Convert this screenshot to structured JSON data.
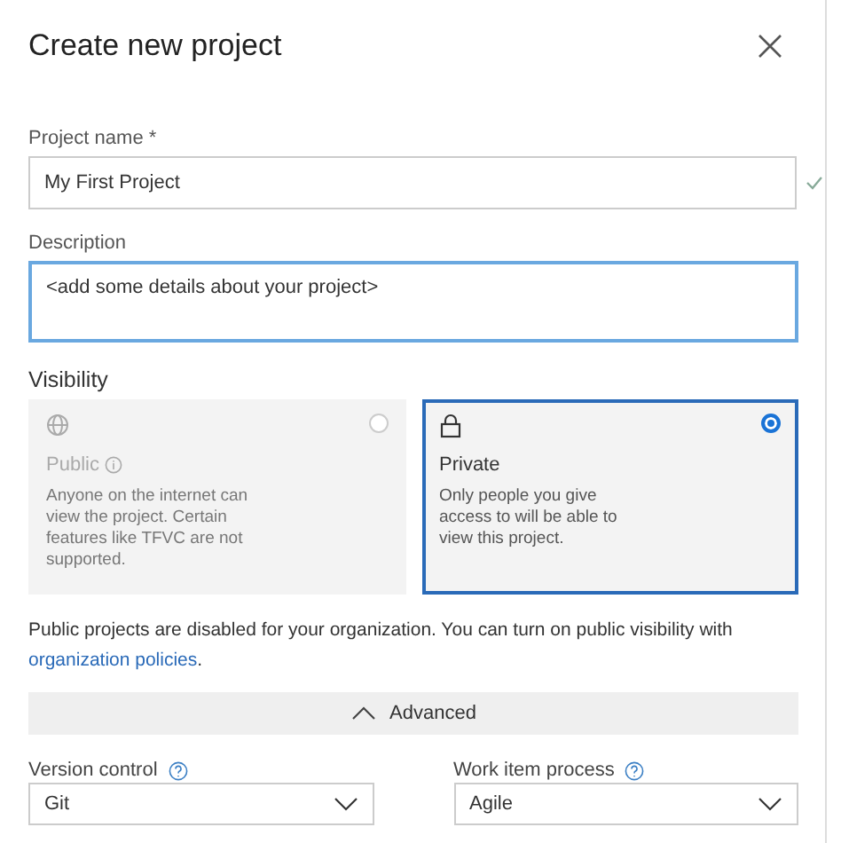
{
  "dialog": {
    "title": "Create new project"
  },
  "project_name": {
    "label": "Project name *",
    "value": "My First Project",
    "valid": true
  },
  "description": {
    "label": "Description",
    "value": "<add some details about your project>",
    "focused": true
  },
  "visibility": {
    "label": "Visibility",
    "options": [
      {
        "kind": "globe",
        "name": "Public",
        "text": "Anyone on the internet can view the project. Certain features like TFVC are not supported.",
        "selected": false,
        "disabled": true
      },
      {
        "kind": "lock",
        "name": "Private",
        "text": "Only people you give access to will be able to view this project.",
        "selected": true,
        "disabled": false
      }
    ]
  },
  "note": {
    "text": "Public projects are disabled for your organization. You can turn on public visibility with",
    "link": "organization policies",
    "end": "."
  },
  "advanced": {
    "label": "Advanced",
    "expanded": true
  },
  "version_control": {
    "label": "Version control",
    "value": "Git"
  },
  "work_item_process": {
    "label": "Work item process",
    "value": "Agile"
  }
}
